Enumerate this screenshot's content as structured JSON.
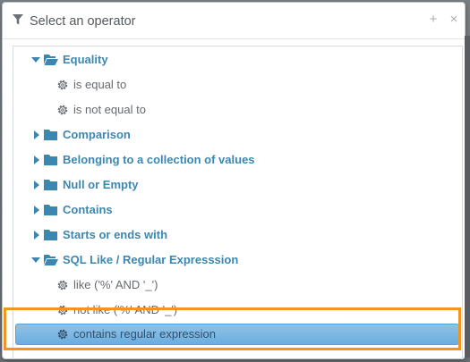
{
  "dialog": {
    "title": "Select an operator",
    "add_label": "+",
    "close_label": "×",
    "title_icon": "filter-icon"
  },
  "colors": {
    "category_text": "#3c87b0",
    "folder_icon": "#3c87b0",
    "selected_background": "#6aaedf",
    "highlight_outline": "#f0961e"
  },
  "tree": [
    {
      "type": "category",
      "label": "Equality",
      "expanded": true,
      "icon": "folder-open-icon"
    },
    {
      "type": "operator",
      "label": "is equal to",
      "icon": "gear-icon"
    },
    {
      "type": "operator",
      "label": "is not equal to",
      "icon": "gear-icon"
    },
    {
      "type": "category",
      "label": "Comparison",
      "expanded": false,
      "icon": "folder-icon"
    },
    {
      "type": "category",
      "label": "Belonging to a collection of values",
      "expanded": false,
      "icon": "folder-icon"
    },
    {
      "type": "category",
      "label": "Null or Empty",
      "expanded": false,
      "icon": "folder-icon"
    },
    {
      "type": "category",
      "label": "Contains",
      "expanded": false,
      "icon": "folder-icon"
    },
    {
      "type": "category",
      "label": "Starts or ends with",
      "expanded": false,
      "icon": "folder-icon"
    },
    {
      "type": "category",
      "label": "SQL Like / Regular Expresssion",
      "expanded": true,
      "icon": "folder-open-icon"
    },
    {
      "type": "operator",
      "label": "like ('%' AND '_')",
      "icon": "gear-icon"
    },
    {
      "type": "operator",
      "label": "not like ('%' AND '_')",
      "icon": "gear-icon"
    },
    {
      "type": "operator",
      "label": "contains regular expression",
      "icon": "gear-icon",
      "selected": true
    }
  ]
}
